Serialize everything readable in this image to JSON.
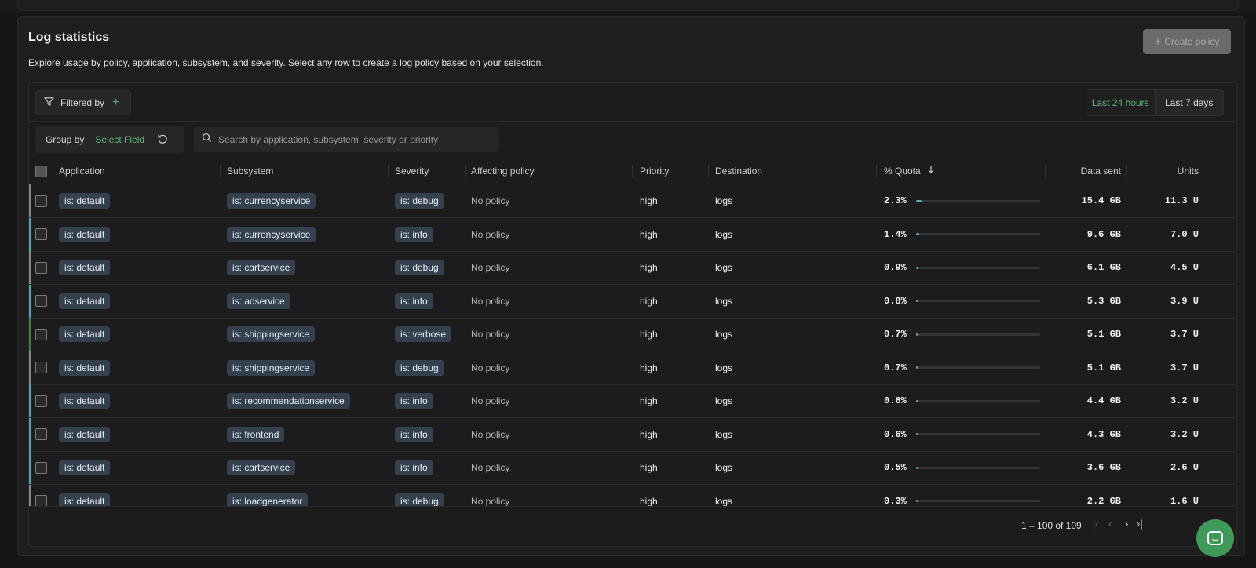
{
  "panel": {
    "title": "Log statistics",
    "description": "Explore usage by policy, application, subsystem, and severity. Select any row to create a log policy based on your selection.",
    "create_button": "Create policy"
  },
  "toolbar": {
    "filter_label": "Filtered by",
    "time_options": [
      "Last 24 hours",
      "Last 7 days"
    ],
    "active_time": "Last 24 hours",
    "group_by_label": "Group by",
    "group_by_value": "Select Field",
    "search_placeholder": "Search by application, subsystem, severity or priority"
  },
  "table": {
    "columns": [
      "Application",
      "Subsystem",
      "Severity",
      "Affecting policy",
      "Priority",
      "Destination",
      "% Quota",
      "Data sent",
      "Units"
    ],
    "sorted_column": "% Quota",
    "sort_direction": "descending",
    "rows": [
      {
        "application": "is: default",
        "subsystem": "is: currencyservice",
        "severity": "is: debug",
        "policy": "No policy",
        "priority": "high",
        "destination": "logs",
        "quota": "2.3%",
        "quota_value": 2.3,
        "data_sent": "15.4 GB",
        "units": "11.3 U",
        "edge": "#8a8a8a"
      },
      {
        "application": "is: default",
        "subsystem": "is: currencyservice",
        "severity": "is: info",
        "policy": "No policy",
        "priority": "high",
        "destination": "logs",
        "quota": "1.4%",
        "quota_value": 1.4,
        "data_sent": "9.6 GB",
        "units": "7.0 U",
        "edge": "#4aa7b8"
      },
      {
        "application": "is: default",
        "subsystem": "is: cartservice",
        "severity": "is: debug",
        "policy": "No policy",
        "priority": "high",
        "destination": "logs",
        "quota": "0.9%",
        "quota_value": 0.9,
        "data_sent": "6.1 GB",
        "units": "4.5 U",
        "edge": "#8a8a8a"
      },
      {
        "application": "is: default",
        "subsystem": "is: adservice",
        "severity": "is: info",
        "policy": "No policy",
        "priority": "high",
        "destination": "logs",
        "quota": "0.8%",
        "quota_value": 0.8,
        "data_sent": "5.3 GB",
        "units": "3.9 U",
        "edge": "#4aa7b8"
      },
      {
        "application": "is: default",
        "subsystem": "is: shippingservice",
        "severity": "is: verbose",
        "policy": "No policy",
        "priority": "high",
        "destination": "logs",
        "quota": "0.7%",
        "quota_value": 0.7,
        "data_sent": "5.1 GB",
        "units": "3.7 U",
        "edge": "#3f7a4a"
      },
      {
        "application": "is: default",
        "subsystem": "is: shippingservice",
        "severity": "is: debug",
        "policy": "No policy",
        "priority": "high",
        "destination": "logs",
        "quota": "0.7%",
        "quota_value": 0.7,
        "data_sent": "5.1 GB",
        "units": "3.7 U",
        "edge": "#8a8a8a"
      },
      {
        "application": "is: default",
        "subsystem": "is: recommendationservice",
        "severity": "is: info",
        "policy": "No policy",
        "priority": "high",
        "destination": "logs",
        "quota": "0.6%",
        "quota_value": 0.6,
        "data_sent": "4.4 GB",
        "units": "3.2 U",
        "edge": "#4aa7b8"
      },
      {
        "application": "is: default",
        "subsystem": "is: frontend",
        "severity": "is: info",
        "policy": "No policy",
        "priority": "high",
        "destination": "logs",
        "quota": "0.6%",
        "quota_value": 0.6,
        "data_sent": "4.3 GB",
        "units": "3.2 U",
        "edge": "#4aa7b8"
      },
      {
        "application": "is: default",
        "subsystem": "is: cartservice",
        "severity": "is: info",
        "policy": "No policy",
        "priority": "high",
        "destination": "logs",
        "quota": "0.5%",
        "quota_value": 0.5,
        "data_sent": "3.6 GB",
        "units": "2.6 U",
        "edge": "#4aa7b8"
      },
      {
        "application": "is: default",
        "subsystem": "is: loadgenerator",
        "severity": "is: debug",
        "policy": "No policy",
        "priority": "high",
        "destination": "logs",
        "quota": "0.3%",
        "quota_value": 0.3,
        "data_sent": "2.2 GB",
        "units": "1.6 U",
        "edge": "#8a8a8a"
      }
    ]
  },
  "pagination": {
    "range": "1 – 100 of 109"
  },
  "colors": {
    "accent_green": "#5cb87a",
    "quota_bar": "#5fa6b4",
    "tag_bg": "#35404f"
  }
}
